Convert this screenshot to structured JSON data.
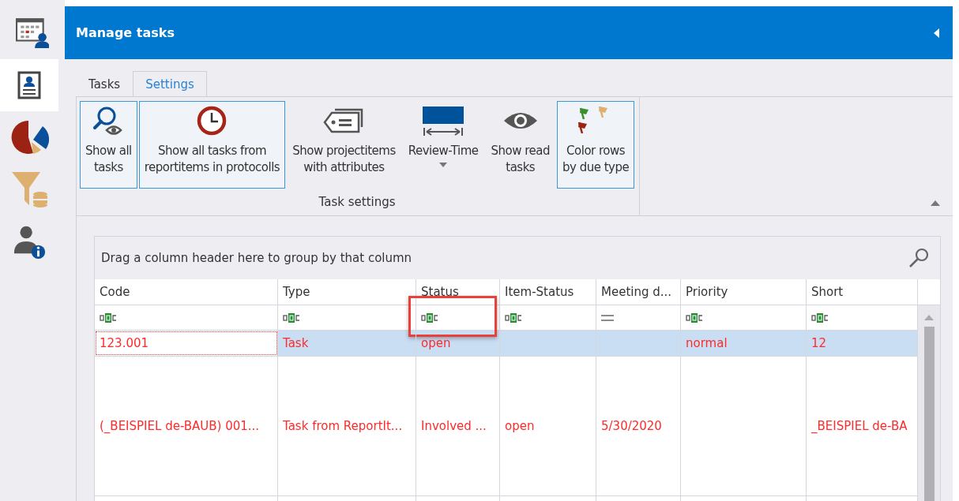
{
  "header": {
    "title": "Manage tasks"
  },
  "sidebar": {
    "items": [
      {
        "kind": "contact",
        "selected": true
      },
      {
        "kind": "pie",
        "selected": false
      },
      {
        "kind": "funnel",
        "selected": false
      },
      {
        "kind": "info",
        "selected": false
      }
    ]
  },
  "tabs": [
    {
      "label": "Tasks",
      "selected": false
    },
    {
      "label": "Settings",
      "selected": true
    }
  ],
  "ribbon": {
    "group_label": "Task settings",
    "buttons": [
      {
        "kind": "search-eye",
        "label": "Show all\ntasks",
        "checked": true
      },
      {
        "kind": "clock",
        "label": "Show all tasks from\nreportitems in protocolls",
        "checked": true
      },
      {
        "kind": "tag",
        "label": "Show projectitems\nwith attributes",
        "checked": false
      },
      {
        "kind": "timeline",
        "label": "Review-Time",
        "checked": false,
        "dropdown": true
      },
      {
        "kind": "eye",
        "label": "Show read\ntasks",
        "checked": false
      },
      {
        "kind": "flags",
        "label": "Color rows\nby due type",
        "checked": true
      }
    ]
  },
  "grid": {
    "group_panel": "Drag a column header here to group by that column",
    "columns": [
      {
        "label": "Code",
        "kind": "text"
      },
      {
        "label": "Type",
        "kind": "text"
      },
      {
        "label": "Status",
        "kind": "text",
        "highlighted": true
      },
      {
        "label": "Item-Status",
        "kind": "text"
      },
      {
        "label": "Meeting d...",
        "kind": "date"
      },
      {
        "label": "Priority",
        "kind": "text"
      },
      {
        "label": "Short",
        "kind": "text"
      }
    ],
    "rows": [
      {
        "selected": true,
        "color": "#ff2a2a",
        "cells": [
          "123.001",
          "Task",
          "open",
          "",
          "",
          "normal",
          "12"
        ]
      },
      {
        "selected": false,
        "color": "#ff2a2a",
        "cells": [
          "(_BEISPIEL de-BAUB) 001...",
          "Task from ReportIt...",
          "Involved ...",
          "open",
          "5/30/2020",
          "",
          "_BEISPIEL de-BA"
        ]
      }
    ]
  }
}
